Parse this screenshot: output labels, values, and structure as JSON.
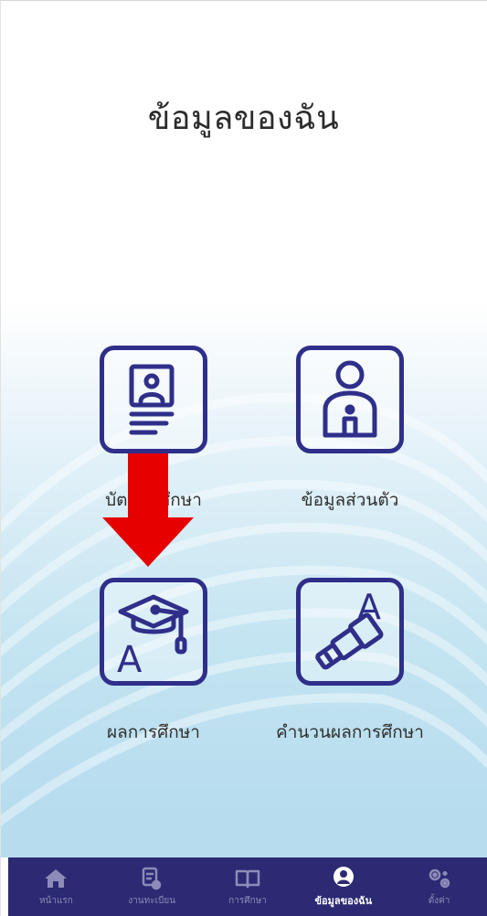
{
  "header": {
    "title": "ข้อมูลของฉัน"
  },
  "menu": {
    "items": [
      {
        "label": "บัตรนักศึกษา",
        "icon": "student-id-card-icon"
      },
      {
        "label": "ข้อมูลส่วนตัว",
        "icon": "person-icon"
      },
      {
        "label": "ผลการศึกษา",
        "icon": "grade-cap-icon"
      },
      {
        "label": "คำนวนผลการศึกษา",
        "icon": "telescope-grade-icon"
      }
    ]
  },
  "annotation": {
    "arrow_color": "#e60000",
    "arrow_direction": "down"
  },
  "tabbar": {
    "items": [
      {
        "label": "หน้าแรก",
        "icon": "home-icon",
        "active": false
      },
      {
        "label": "งานทะเบียน",
        "icon": "registration-icon",
        "active": false
      },
      {
        "label": "การศึกษา",
        "icon": "book-icon",
        "active": false
      },
      {
        "label": "ข้อมูลของฉัน",
        "icon": "profile-icon",
        "active": true
      },
      {
        "label": "ตั้งค่า",
        "icon": "settings-icon",
        "active": false
      }
    ]
  },
  "colors": {
    "accent": "#2f2f8a",
    "tabbar_bg": "#2b2a72",
    "tab_active": "#ffffff",
    "tab_inactive": "#8d8cb8"
  }
}
